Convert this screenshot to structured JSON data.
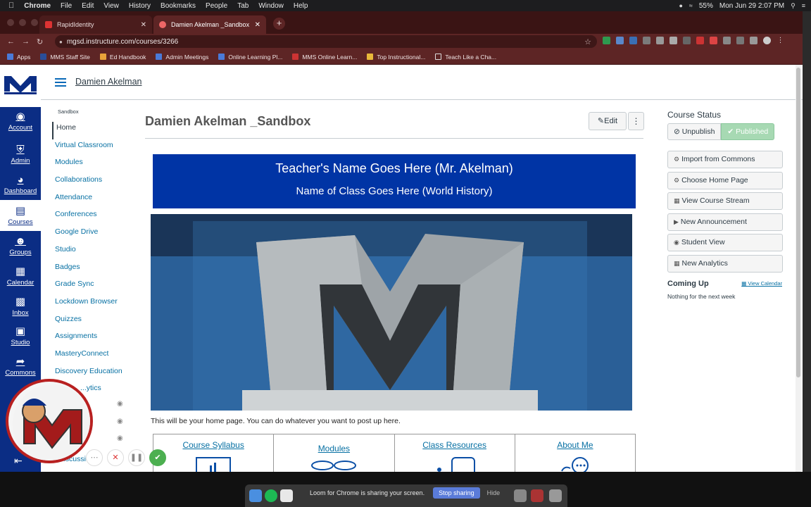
{
  "mac_menu": {
    "app": "Chrome",
    "items": [
      "File",
      "Edit",
      "View",
      "History",
      "Bookmarks",
      "People",
      "Tab",
      "Window",
      "Help"
    ],
    "battery": "55%",
    "clock": "Mon Jun 29  2:07 PM"
  },
  "browser": {
    "tabs": [
      {
        "label": "RapidIdentity"
      },
      {
        "label": "Damien Akelman _Sandbox"
      }
    ],
    "url": "mgsd.instructure.com/courses/3266",
    "bookmarks": [
      "Apps",
      "MMS Staff Site",
      "Ed Handbook",
      "Admin Meetings",
      "Online Learning Pl...",
      "MMS Online Learn...",
      "Top Instructional...",
      "Teach Like a Cha..."
    ]
  },
  "global_nav": {
    "items": [
      {
        "label": "Account",
        "icon": "account-icon"
      },
      {
        "label": "Admin",
        "icon": "shield-icon"
      },
      {
        "label": "Dashboard",
        "icon": "dashboard-icon"
      },
      {
        "label": "Courses",
        "icon": "book-icon"
      },
      {
        "label": "Groups",
        "icon": "groups-icon"
      },
      {
        "label": "Calendar",
        "icon": "calendar-icon"
      },
      {
        "label": "Inbox",
        "icon": "inbox-icon"
      },
      {
        "label": "Studio",
        "icon": "studio-icon"
      },
      {
        "label": "Commons",
        "icon": "commons-icon"
      }
    ]
  },
  "header": {
    "breadcrumb": "Damien Akelman"
  },
  "course_nav": {
    "subtitle": "Sandbox",
    "items": [
      "Home",
      "Virtual Classroom",
      "Modules",
      "Collaborations",
      "Attendance",
      "Conferences",
      "Google Drive",
      "Studio",
      "Badges",
      "Grade Sync",
      "Lockdown Browser",
      "Quizzes",
      "Assignments",
      "MasteryConnect",
      "Discovery Education",
      "...ytics"
    ],
    "hidden_tail": "...scussions"
  },
  "main": {
    "title": "Damien Akelman _Sandbox",
    "edit_label": "Edit",
    "banner_line1": "Teacher's Name Goes Here (Mr. Akelman)",
    "banner_line2": "Name of Class Goes Here (World History)",
    "intro": "This will be your home page.  You can do whatever you want to post up here.",
    "links": [
      "Course Syllabus",
      "Modules",
      "Class Resources",
      "About Me"
    ]
  },
  "sidebar": {
    "status_heading": "Course Status",
    "unpublish": "Unpublish",
    "published": "Published",
    "buttons": [
      "Import from Commons",
      "Choose Home Page",
      "View Course Stream",
      "New Announcement",
      "Student View",
      "New Analytics"
    ],
    "coming_up": "Coming Up",
    "view_calendar": "View Calendar",
    "nothing": "Nothing for the next week"
  },
  "share_banner": {
    "text": "Loom for Chrome is sharing your screen.",
    "stop": "Stop sharing",
    "hide": "Hide"
  },
  "colors": {
    "nav_blue": "#0b2d84",
    "banner_blue": "#0034a5",
    "link_blue": "#0770a3",
    "published_green": "#a7d9b3",
    "chrome_frame": "#5d2525"
  }
}
